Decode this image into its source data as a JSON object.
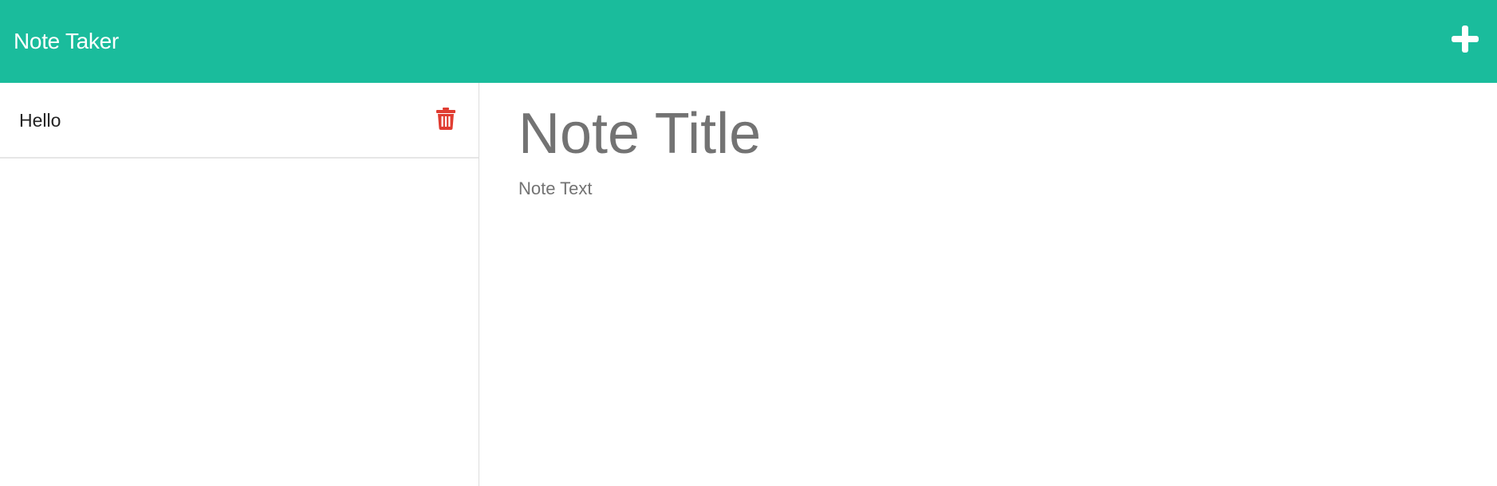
{
  "navbar": {
    "brand": "Note Taker",
    "new_note_icon": "plus-icon"
  },
  "notes": [
    {
      "title": "Hello",
      "delete_icon": "trash-icon"
    }
  ],
  "editor": {
    "title_placeholder": "Note Title",
    "text_placeholder": "Note Text"
  },
  "colors": {
    "navbar_bg": "#1abc9c",
    "delete_icon": "#e03c31",
    "placeholder": "#737373"
  }
}
